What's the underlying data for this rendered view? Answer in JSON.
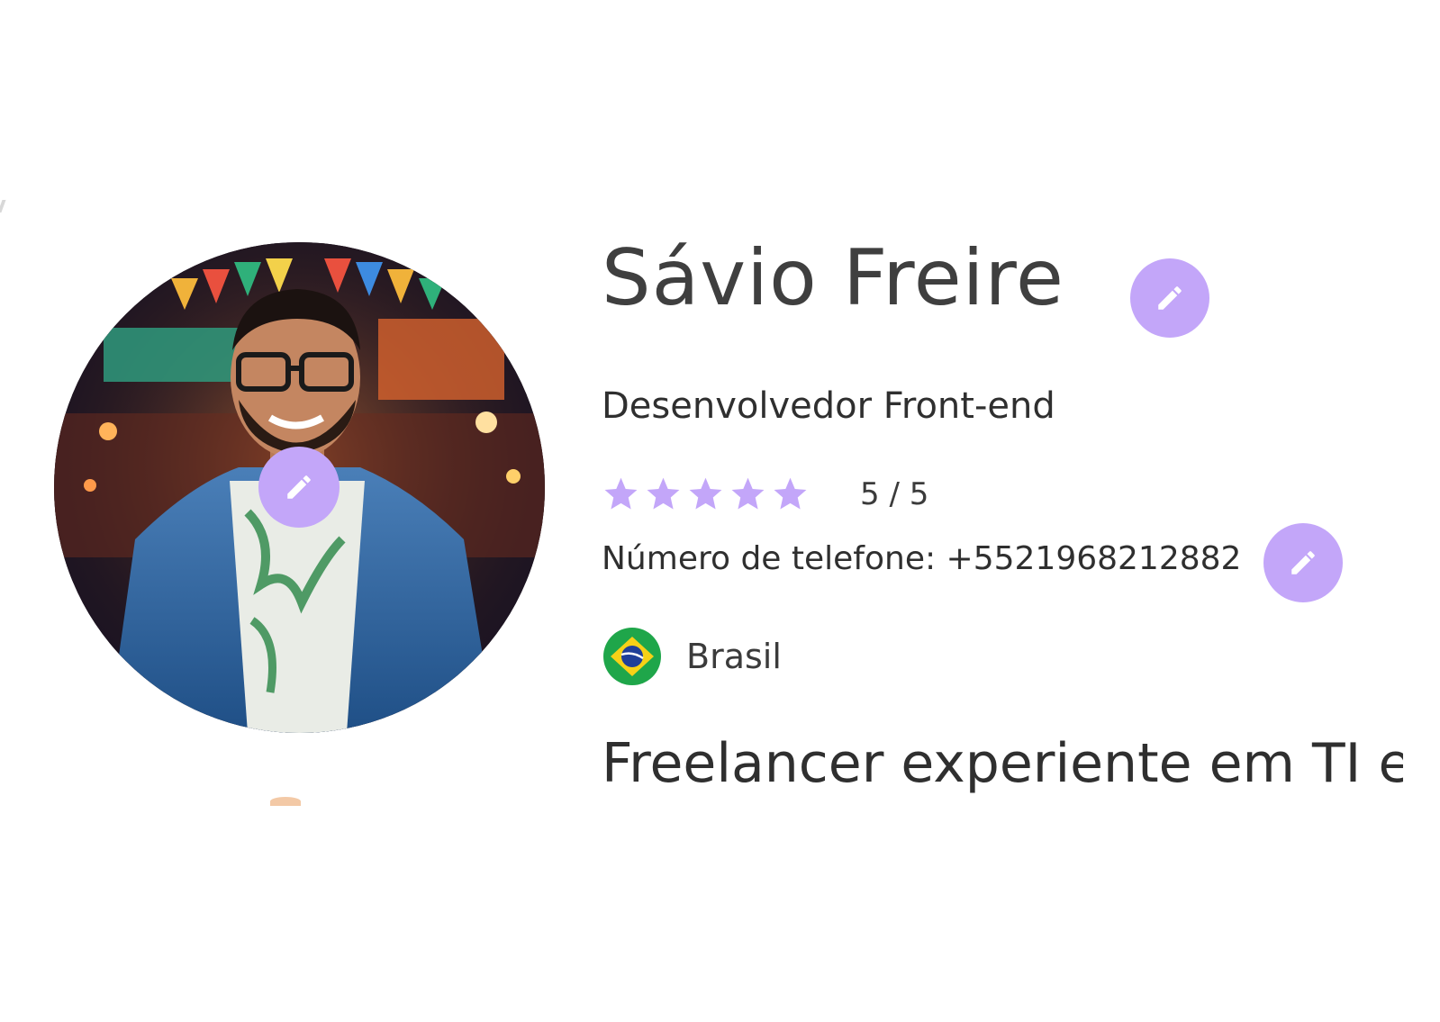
{
  "profile": {
    "name": "Sávio Freire",
    "role": "Desenvolvedor Front-end",
    "rating": {
      "stars_filled": 5,
      "stars_total": 5,
      "text": "5 / 5"
    },
    "phone_text": "Número de telefone: +5521968212882",
    "country": "Brasil",
    "bio_preview": "Freelancer experiente em TI e"
  },
  "icons": {
    "edit": "pencil-icon",
    "star": "star-icon",
    "flag": "brazil-flag-icon"
  },
  "colors": {
    "accent": "#c3a6f9",
    "text_dark": "#3f3f3f",
    "background": "#ffffff"
  }
}
